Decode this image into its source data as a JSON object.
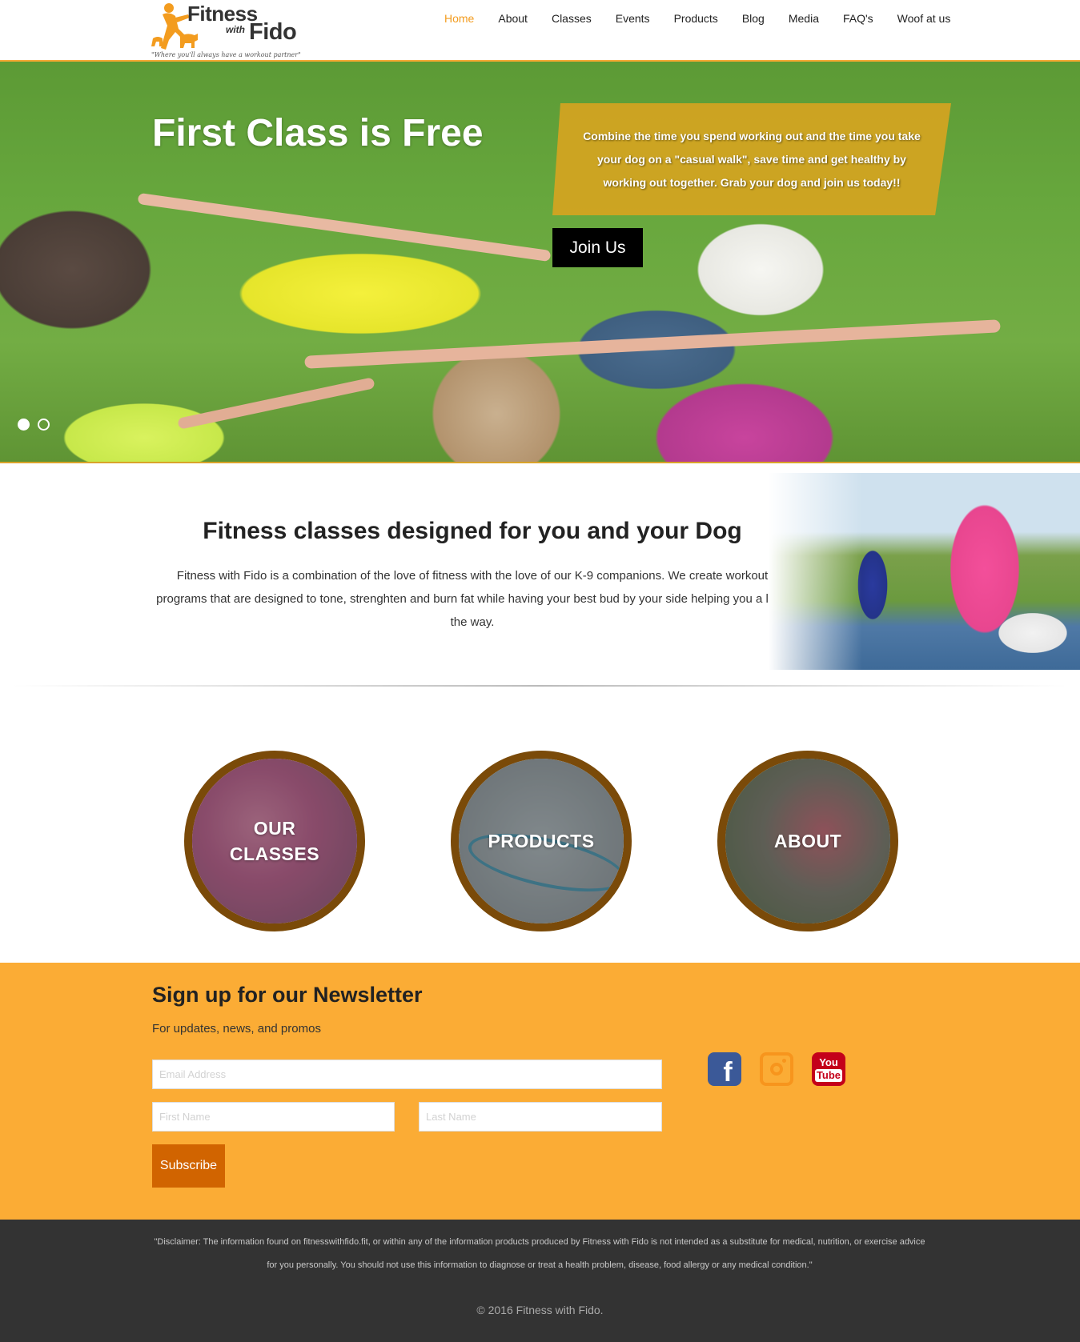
{
  "header": {
    "logo": {
      "title_line1": "Fitness",
      "title_with": "with",
      "title_line2": "Fido",
      "tagline": "\"Where you'll always have a workout partner\""
    },
    "nav": [
      {
        "label": "Home",
        "active": true
      },
      {
        "label": "About"
      },
      {
        "label": "Classes"
      },
      {
        "label": "Events"
      },
      {
        "label": "Products"
      },
      {
        "label": "Blog"
      },
      {
        "label": "Media"
      },
      {
        "label": "FAQ's"
      },
      {
        "label": "Woof at us"
      }
    ]
  },
  "hero": {
    "title": "First Class is Free",
    "callout": "Combine the time you spend working out and the time you take your dog on a \"casual walk\", save time and get healthy by working out together. Grab your dog and join us today!!",
    "button": "Join Us",
    "slides": 2,
    "active_slide": 1
  },
  "intro": {
    "title": "Fitness classes designed for you and your Dog",
    "text": "Fitness with Fido is a combination of the love of fitness with the love of our K-9 companions. We create workout programs that are designed to tone, strenghten and burn fat while having your best bud by your side helping you a long the way."
  },
  "features": [
    {
      "label": "OUR CLASSES"
    },
    {
      "label": "PRODUCTS"
    },
    {
      "label": "ABOUT"
    }
  ],
  "newsletter": {
    "title": "Sign up for our Newsletter",
    "subtitle": "For updates, news, and promos",
    "email_placeholder": "Email Address",
    "first_placeholder": "First Name",
    "last_placeholder": "Last Name",
    "button": "Subscribe",
    "social": [
      {
        "icon": "facebook-icon",
        "color": "#3b5998"
      },
      {
        "icon": "instagram-icon",
        "color": "#f7951d"
      },
      {
        "icon": "youtube-icon",
        "color": "#c4001a",
        "text1": "You",
        "text2": "Tube"
      }
    ]
  },
  "footer": {
    "disclaimer": "\"Disclaimer: The information found on fitnesswithfido.fit, or within any of the information products produced by Fitness with Fido is not intended as a substitute for medical, nutrition, or exercise advice for you personally. You should not use this information to diagnose or treat a health problem, disease, food allergy or any medical condition.\"",
    "copyright": "© 2016 Fitness with Fido."
  },
  "colors": {
    "accent": "#f39c1f",
    "newsletter_bg": "#fbac35",
    "button_dark": "#d16400",
    "footer_bg": "#333333",
    "circle_border": "#7a4a09"
  }
}
